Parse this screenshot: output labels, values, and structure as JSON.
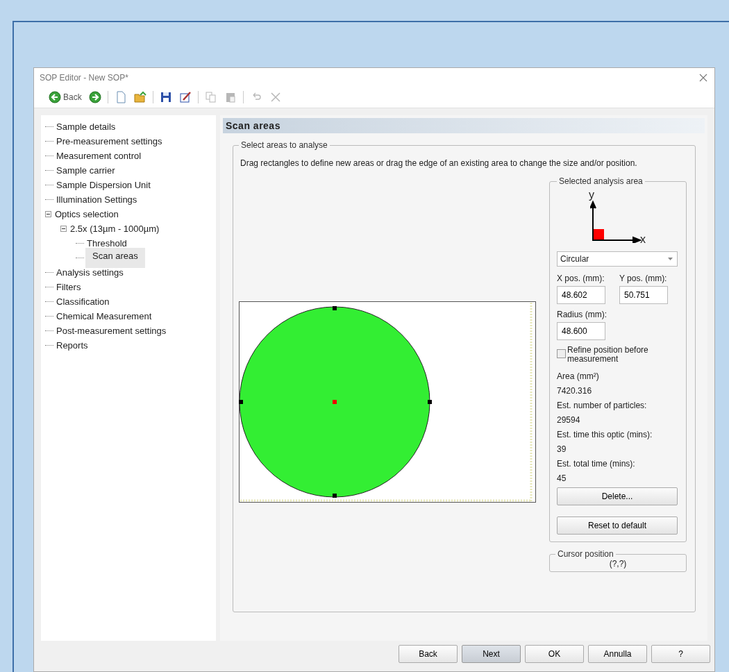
{
  "window": {
    "title": "SOP Editor - New SOP*"
  },
  "toolbar": [
    {
      "kind": "back",
      "label": "Back",
      "disabled": false
    },
    {
      "kind": "forward",
      "disabled": false
    },
    {
      "kind": "separator"
    },
    {
      "kind": "new",
      "disabled": false
    },
    {
      "kind": "open",
      "disabled": false
    },
    {
      "kind": "separator"
    },
    {
      "kind": "save",
      "disabled": false
    },
    {
      "kind": "edit",
      "disabled": false
    },
    {
      "kind": "separator"
    },
    {
      "kind": "copy",
      "disabled": true
    },
    {
      "kind": "paste",
      "disabled": true
    },
    {
      "kind": "separator"
    },
    {
      "kind": "undo",
      "disabled": true
    },
    {
      "kind": "delete",
      "disabled": true
    }
  ],
  "tree": [
    {
      "label": "Sample details",
      "selected": false
    },
    {
      "label": "Pre-measurement settings",
      "selected": false
    },
    {
      "label": "Measurement control",
      "selected": false
    },
    {
      "label": "Sample carrier",
      "selected": false
    },
    {
      "label": "Sample Dispersion Unit",
      "selected": false
    },
    {
      "label": "Illumination Settings",
      "selected": false
    },
    {
      "label": "Optics selection",
      "selected": false,
      "expanded": true,
      "children": [
        {
          "label": "2.5x (13µm - 1000µm)",
          "selected": false,
          "expanded": true,
          "children": [
            {
              "label": "Threshold",
              "selected": false
            },
            {
              "label": "Scan areas",
              "selected": true
            }
          ]
        }
      ]
    },
    {
      "label": "Analysis settings",
      "selected": false
    },
    {
      "label": "Filters",
      "selected": false
    },
    {
      "label": "Classification",
      "selected": false
    },
    {
      "label": "Chemical Measurement",
      "selected": false
    },
    {
      "label": "Post-measurement settings",
      "selected": false
    },
    {
      "label": "Reports",
      "selected": false
    }
  ],
  "panel": {
    "title": "Scan areas",
    "group_title": "Select areas to analyse",
    "instructions": "Drag rectangles to define new areas or drag the edge of an existing area to change the size and/or position.",
    "selected_area": {
      "title": "Selected analysis area",
      "axis_x": "x",
      "axis_y": "y",
      "shape": "Circular",
      "x_pos": {
        "label": "X pos. (mm):",
        "value": "48.602"
      },
      "y_pos": {
        "label": "Y pos. (mm):",
        "value": "50.751"
      },
      "radius": {
        "label": "Radius (mm):",
        "value": "48.600"
      },
      "refine": {
        "label": "Refine position before measurement",
        "checked": false
      },
      "stats": [
        {
          "label": "Area (mm²)",
          "value": "7420.316"
        },
        {
          "label": "Est. number of particles:",
          "value": "29594"
        },
        {
          "label": "Est. time this optic (mins):",
          "value": "39"
        },
        {
          "label": "Est. total time (mins):",
          "value": "45"
        }
      ],
      "buttons": [
        {
          "label": "Delete..."
        },
        {
          "label": "Reset to default"
        }
      ]
    },
    "cursor": {
      "title": "Cursor position",
      "value": "(?,?)"
    }
  },
  "footer_buttons": [
    {
      "label": "Back",
      "selected": false
    },
    {
      "label": "Next",
      "selected": true
    },
    {
      "label": "OK",
      "selected": false
    },
    {
      "label": "Annulla",
      "selected": false
    },
    {
      "label": "?",
      "selected": false
    }
  ]
}
